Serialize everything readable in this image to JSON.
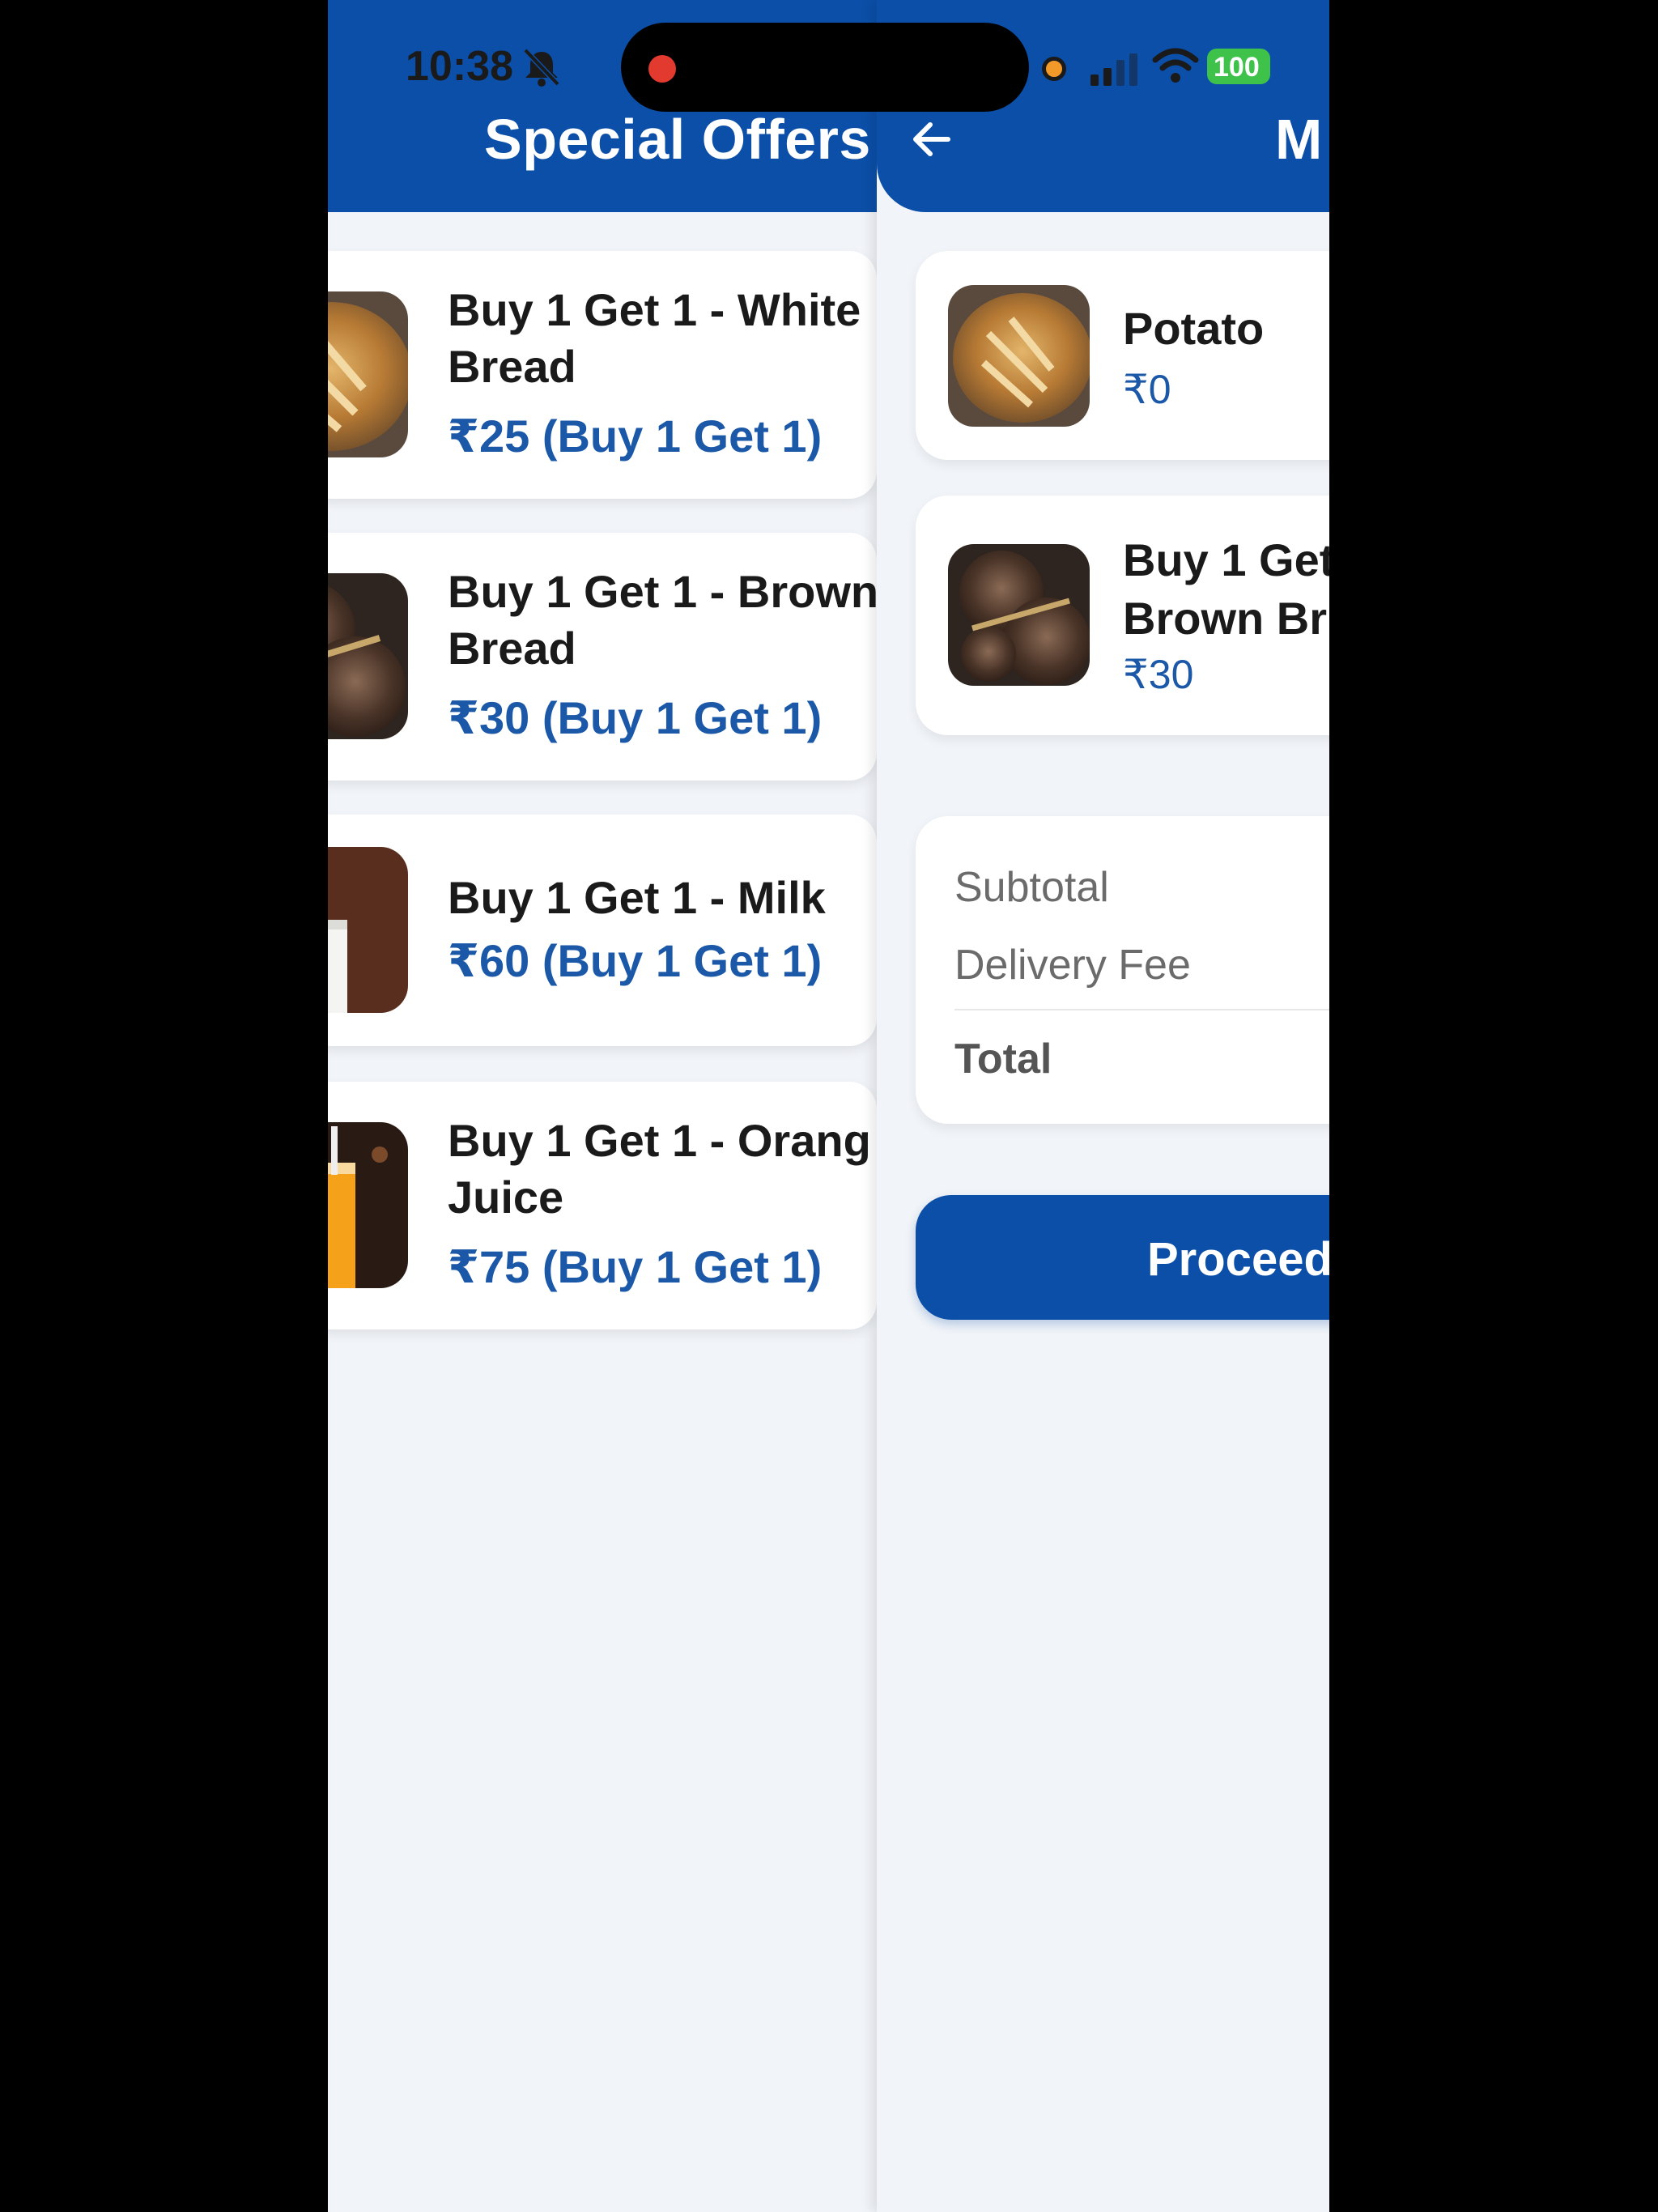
{
  "status_bar": {
    "time": "10:38",
    "battery": "100",
    "icons": [
      "bell-slash-icon",
      "recording-dot-icon",
      "signal-icon",
      "wifi-icon",
      "battery-icon"
    ]
  },
  "offers_screen": {
    "title": "Special Offers",
    "items": [
      {
        "name_line1": "Buy 1 Get 1 - White",
        "name_line2": "Bread",
        "price": "₹25 (Buy 1 Get 1)",
        "image": "white-bread"
      },
      {
        "name_line1": "Buy 1 Get 1 - Brown",
        "name_line2": "Bread",
        "price": "₹30 (Buy 1 Get 1)",
        "image": "brown-bread"
      },
      {
        "name_line1": "Buy 1 Get 1 - Milk",
        "name_line2": "",
        "price": "₹60 (Buy 1 Get 1)",
        "image": "milk"
      },
      {
        "name_line1": "Buy 1 Get 1 - Orang",
        "name_line2": "Juice",
        "price": "₹75 (Buy 1 Get 1)",
        "image": "orange-juice"
      }
    ]
  },
  "cart_screen": {
    "title": "M",
    "back_icon": "arrow-left-icon",
    "items": [
      {
        "name_line1": "Potato",
        "name_line2": "",
        "price": "₹0",
        "image": "white-bread"
      },
      {
        "name_line1": "Buy 1 Get",
        "name_line2": "Brown Br",
        "price": "₹30",
        "image": "brown-bread"
      }
    ],
    "summary": {
      "subtotal_label": "Subtotal",
      "delivery_label": "Delivery Fee",
      "total_label": "Total"
    },
    "proceed_label": "Proceed"
  },
  "colors": {
    "brand_blue": "#0b4fa8",
    "price_blue": "#1b58a8",
    "background": "#f1f4f8",
    "battery_green": "#3fc24a"
  }
}
